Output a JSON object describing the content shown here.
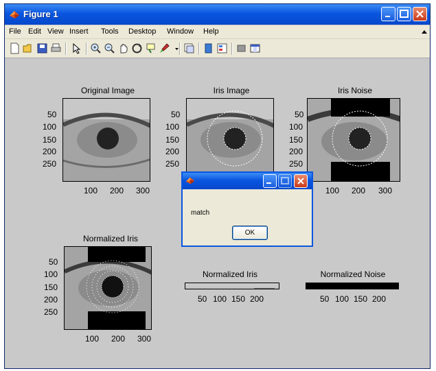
{
  "window": {
    "title": "Figure 1"
  },
  "menu": [
    "File",
    "Edit",
    "View",
    "Insert",
    "Tools",
    "Desktop",
    "Window",
    "Help"
  ],
  "toolbar_icons": [
    "new-figure-icon",
    "open-file-icon",
    "save-icon",
    "print-icon",
    "pointer-icon",
    "zoom-in-icon",
    "zoom-out-icon",
    "pan-icon",
    "rotate-3d-icon",
    "data-cursor-icon",
    "brush-icon",
    "link-icon",
    "colorbar-icon",
    "legend-icon",
    "hide-plot-tools-icon",
    "show-plot-tools-icon"
  ],
  "plots": {
    "original": {
      "title": "Original Image",
      "y_ticks": [
        "50",
        "100",
        "150",
        "200",
        "250"
      ],
      "x_ticks": [
        "100",
        "200",
        "300"
      ]
    },
    "iris": {
      "title": "Iris Image",
      "y_ticks": [
        "50",
        "100",
        "150",
        "200",
        "250"
      ],
      "x_ticks": []
    },
    "noise": {
      "title": "Iris Noise",
      "y_ticks": [
        "50",
        "100",
        "150",
        "200",
        "250"
      ],
      "x_ticks": [
        "100",
        "200",
        "300"
      ]
    },
    "norm_big": {
      "title": "Normalized Iris",
      "y_ticks": [
        "50",
        "100",
        "150",
        "200",
        "250"
      ],
      "x_ticks": [
        "100",
        "200",
        "300"
      ]
    },
    "norm_iris": {
      "title": "Normalized Iris",
      "x_ticks": [
        "50",
        "100",
        "150",
        "200"
      ]
    },
    "norm_noise": {
      "title": "Normalized Noise",
      "x_ticks": [
        "50",
        "100",
        "150",
        "200"
      ]
    }
  },
  "dialog": {
    "message": "match",
    "ok_label": "OK"
  }
}
